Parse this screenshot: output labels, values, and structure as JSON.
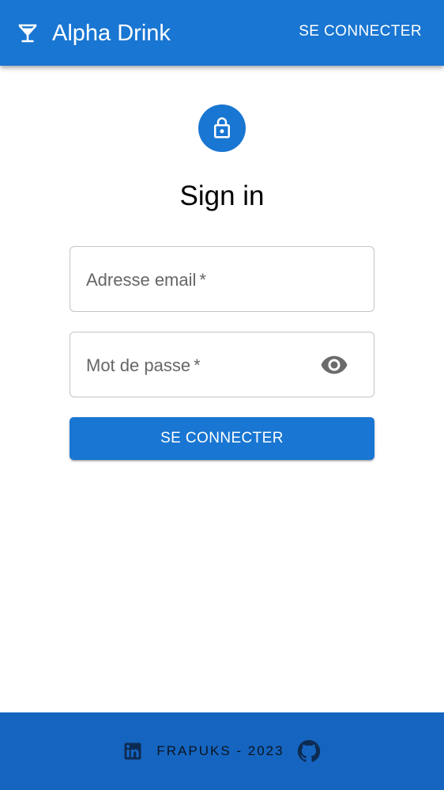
{
  "appbar": {
    "title": "Alpha Drink",
    "brand_icon": "cocktail-glass-icon",
    "login_label": "SE CONNECTER"
  },
  "main": {
    "avatar_icon": "lock-icon",
    "heading": "Sign in",
    "email_field": {
      "label": "Adresse email",
      "required_mark": "*",
      "value": ""
    },
    "password_field": {
      "label": "Mot de passe",
      "required_mark": "*",
      "value": "",
      "toggle_icon": "eye-icon"
    },
    "submit_label": "SE CONNECTER"
  },
  "footer": {
    "text": "FRAPUKS - 2023",
    "left_icon": "linkedin-icon",
    "right_icon": "github-icon"
  },
  "colors": {
    "primary": "#1976d2",
    "footer_bg": "#1565c0",
    "footer_icon": "#0d2b52",
    "field_border": "#c4c4c4",
    "label_text": "#666666"
  }
}
